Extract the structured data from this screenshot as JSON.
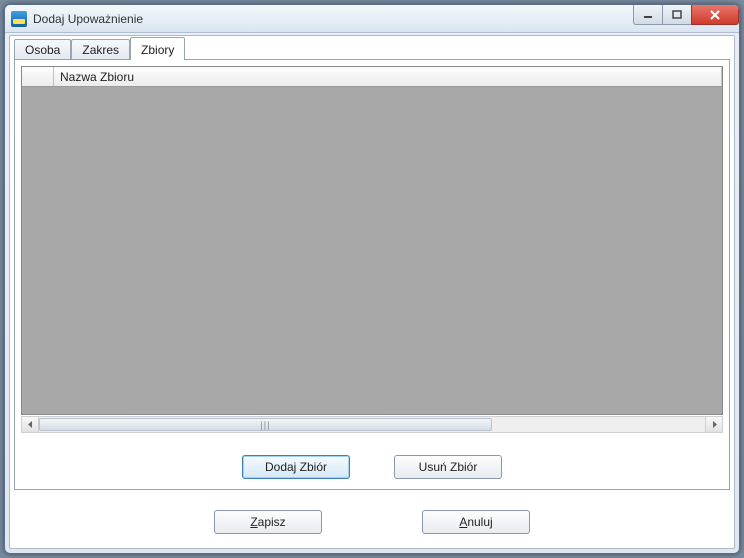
{
  "window": {
    "title": "Dodaj Upoważnienie"
  },
  "tabs": [
    {
      "label": "Osoba",
      "active": false
    },
    {
      "label": "Zakres",
      "active": false
    },
    {
      "label": "Zbiory",
      "active": true
    }
  ],
  "grid": {
    "columns": {
      "selector": "",
      "name": "Nazwa Zbioru"
    },
    "scroll_grip": "|||"
  },
  "buttons": {
    "add": "Dodaj Zbiór",
    "remove": "Usuń Zbiór",
    "save_prefix": "Z",
    "save_rest": "apisz",
    "cancel_prefix": "A",
    "cancel_rest": "nuluj"
  }
}
